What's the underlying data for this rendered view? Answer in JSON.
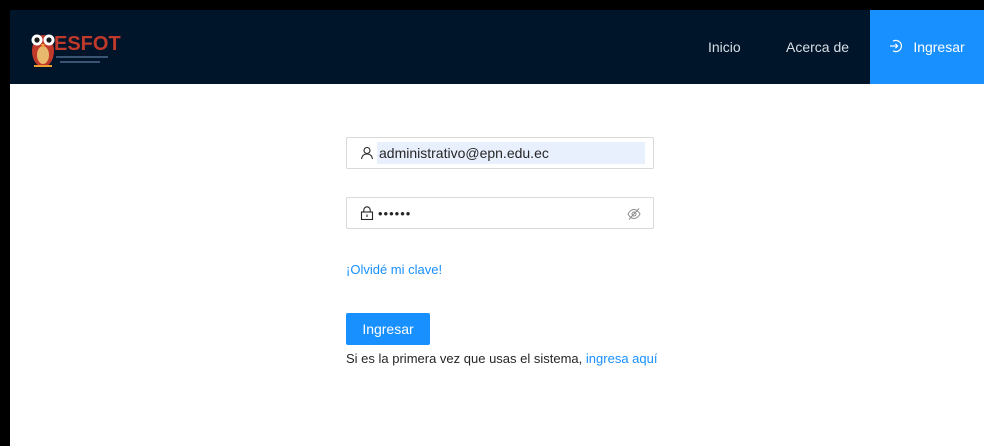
{
  "header": {
    "logo_text": "ESFOT",
    "nav": {
      "inicio": "Inicio",
      "acerca": "Acerca de",
      "ingresar": "Ingresar"
    }
  },
  "login": {
    "user_value": "administrativo@epn.edu.ec",
    "password_mask": "••••••",
    "forgot_link": "¡Olvidé mi clave!",
    "submit_label": "Ingresar",
    "signup_prefix": "Si es la primera vez que usas el sistema,",
    "signup_link": "ingresa aquí"
  },
  "icons": {
    "user": "user-icon",
    "lock": "lock-icon",
    "eye": "eye-invisible-icon",
    "login": "login-icon"
  },
  "colors": {
    "header_bg": "#001529",
    "accent": "#1890ff",
    "autofill_bg": "#e8f0fe",
    "logo_red": "#c0392b"
  }
}
